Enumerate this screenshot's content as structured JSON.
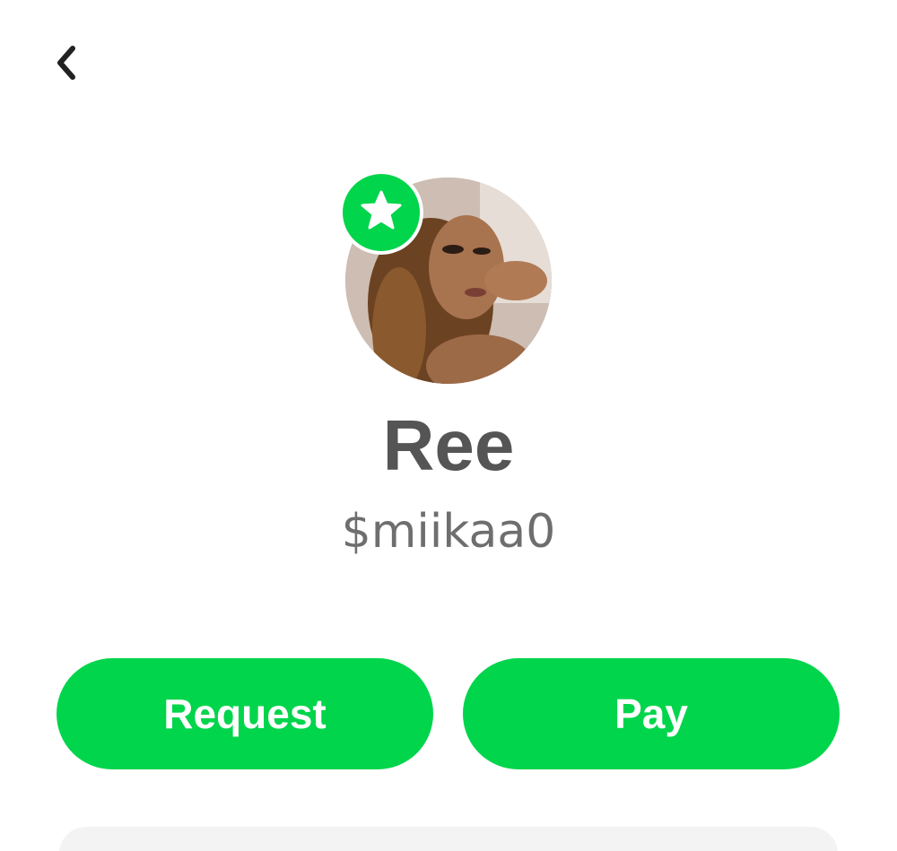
{
  "theme": {
    "accent": "#00d54b",
    "name_color": "#555555",
    "cashtag_color": "#6e6e6e",
    "icon_color": "#222222"
  },
  "header": {
    "back_icon": "chevron-left-icon"
  },
  "profile": {
    "display_name": "Ree",
    "cashtag": "$miikaa0",
    "badge_icon": "star-icon"
  },
  "actions": {
    "request_label": "Request",
    "pay_label": "Pay"
  }
}
